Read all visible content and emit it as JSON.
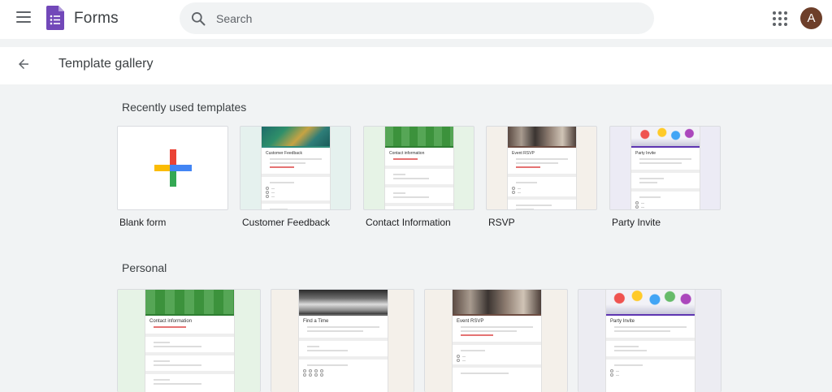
{
  "header": {
    "app_name": "Forms",
    "search_placeholder": "Search",
    "avatar_initial": "A"
  },
  "subheader": {
    "title": "Template gallery"
  },
  "recent": {
    "title": "Recently used templates",
    "items": [
      {
        "label": "Blank form"
      },
      {
        "label": "Customer Feedback",
        "preview_title": "Customer Feedback"
      },
      {
        "label": "Contact Information",
        "preview_title": "Contact information"
      },
      {
        "label": "RSVP",
        "preview_title": "Event RSVP"
      },
      {
        "label": "Party Invite",
        "preview_title": "Party Invite"
      }
    ]
  },
  "personal": {
    "title": "Personal",
    "items": [
      {
        "preview_title": "Contact information"
      },
      {
        "preview_title": "Find a Time"
      },
      {
        "preview_title": "Event RSVP"
      },
      {
        "preview_title": "Party Invite"
      }
    ]
  },
  "colors": {
    "plus_red": "#ea4335",
    "plus_blue": "#4285f4",
    "plus_yellow": "#fbbc04",
    "plus_green": "#34a853",
    "forms_purple": "#673ab7"
  }
}
